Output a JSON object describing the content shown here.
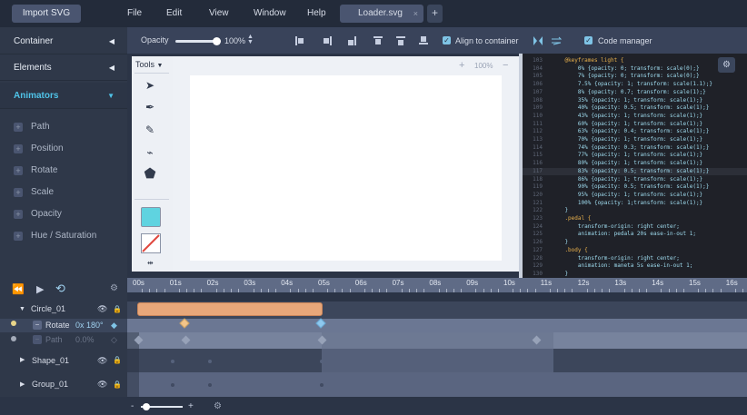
{
  "menubar": {
    "import_label": "Import SVG",
    "menu": [
      "File",
      "Edit",
      "View",
      "Window",
      "Help"
    ],
    "tab_label": "Loader.svg",
    "tab_close": "×",
    "add_tab": "+"
  },
  "sidebar": {
    "sections": [
      {
        "label": "Container",
        "arrow": "◀"
      },
      {
        "label": "Elements",
        "arrow": "◀"
      },
      {
        "label": "Animators",
        "arrow": "▼"
      }
    ],
    "animators": [
      "Path",
      "Position",
      "Rotate",
      "Scale",
      "Opacity",
      "Hue / Saturation"
    ]
  },
  "toolbar": {
    "opacity_label": "Opacity",
    "opacity_value": "100%",
    "opacity_level": 1.0,
    "align_label": "Align to container",
    "code_manager_label": "Code manager"
  },
  "tools": {
    "label": "Tools",
    "icons": [
      "cursor-icon",
      "pen-icon",
      "pencil-icon",
      "eyedropper-icon",
      "polygon-icon"
    ],
    "fill_color": "#5fd3e0",
    "zoom": "100%"
  },
  "code": {
    "lines": [
      {
        "n": "103",
        "t": "    @keyframes light {"
      },
      {
        "n": "104",
        "t": "        0% {opacity: 0; transform: scale(0);}"
      },
      {
        "n": "105",
        "t": "        7% {opacity: 0; transform: scale(0);}"
      },
      {
        "n": "106",
        "t": "        7.5% {opacity: 1; transform: scale(1.1);}"
      },
      {
        "n": "107",
        "t": "        8% {opacity: 0.7; transform: scale(1);}"
      },
      {
        "n": "108",
        "t": "        35% {opacity: 1; transform: scale(1);}"
      },
      {
        "n": "109",
        "t": "        40% {opacity: 0.5; transform: scale(1);}"
      },
      {
        "n": "110",
        "t": "        43% {opacity: 1; transform: scale(1);}"
      },
      {
        "n": "111",
        "t": "        60% {opacity: 1; transform: scale(1);}"
      },
      {
        "n": "112",
        "t": "        63% {opacity: 0.4; transform: scale(1);}"
      },
      {
        "n": "113",
        "t": "        70% {opacity: 1; transform: scale(1);}"
      },
      {
        "n": "114",
        "t": "        74% {opacity: 0.3; transform: scale(1);}"
      },
      {
        "n": "115",
        "t": "        77% {opacity: 1; transform: scale(1);}"
      },
      {
        "n": "116",
        "t": "        80% {opacity: 1; transform: scale(1);}"
      },
      {
        "n": "117",
        "t": "        83% {opacity: 0.5; transform: scale(1);}"
      },
      {
        "n": "118",
        "t": "        86% {opacity: 1; transform: scale(1);}"
      },
      {
        "n": "119",
        "t": "        90% {opacity: 0.5; transform: scale(1);}"
      },
      {
        "n": "120",
        "t": "        95% {opacity: 1; transform: scale(1);}"
      },
      {
        "n": "121",
        "t": "        100% {opacity: 1;transform: scale(1);}"
      },
      {
        "n": "122",
        "t": "    }"
      },
      {
        "n": "123",
        "t": "    .pedal {"
      },
      {
        "n": "124",
        "t": "        transform-origin: right center;"
      },
      {
        "n": "125",
        "t": "        animation: pedala 20s ease-in-out 1;"
      },
      {
        "n": "126",
        "t": "    }"
      },
      {
        "n": "127",
        "t": "    .body {"
      },
      {
        "n": "128",
        "t": "        transform-origin: right center;"
      },
      {
        "n": "129",
        "t": "        animation: maneta 5s ease-in-out 1;"
      },
      {
        "n": "130",
        "t": "    }"
      }
    ]
  },
  "timeline": {
    "ticks": [
      "00s",
      "01s",
      "02s",
      "03s",
      "04s",
      "05s",
      "06s",
      "07s",
      "08s",
      "09s",
      "10s",
      "11s",
      "12s",
      "13s",
      "14s",
      "15s",
      "16s"
    ],
    "rows": [
      {
        "label": "Circle_01"
      },
      {
        "label": "Rotate",
        "value_a": "0x",
        "value_b": "180°"
      },
      {
        "label": "Path",
        "value_a": "0.0%"
      },
      {
        "label": "Shape_01"
      },
      {
        "label": "Group_01"
      }
    ],
    "zoom_minus": "-",
    "zoom_plus": "+",
    "colors": {
      "bar": "#e8a77a",
      "keyframe_gold": "#f3c58a",
      "keyframe_blue": "#8ec8ee"
    }
  }
}
